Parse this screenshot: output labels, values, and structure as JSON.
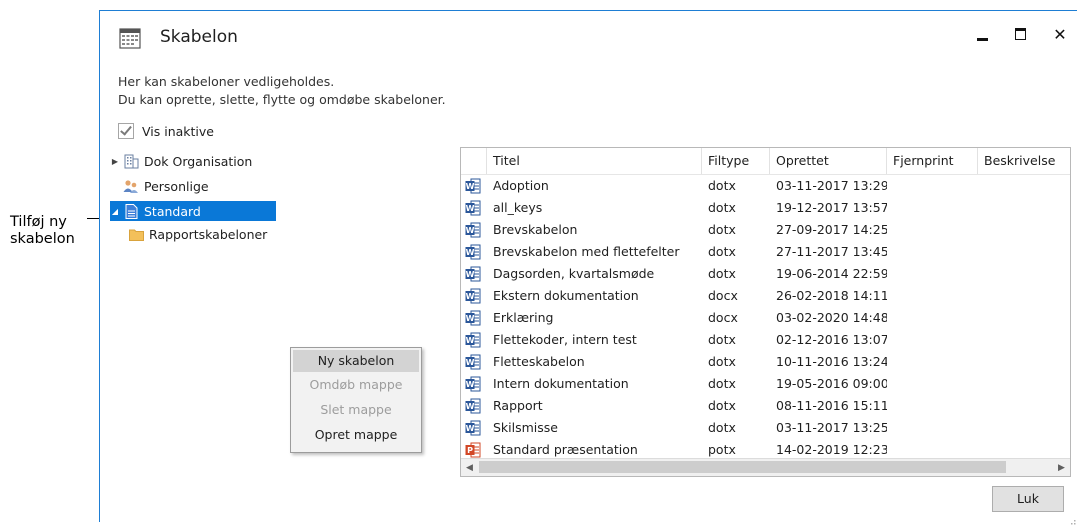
{
  "callout": {
    "text": "Tilføj ny skabelon"
  },
  "window": {
    "title": "Skabelon",
    "close_glyph": "✕",
    "description": [
      "Her kan skabeloner vedligeholdes.",
      "Du kan oprette, slette, flytte og omdøbe skabeloner."
    ],
    "show_inactive_label": "Vis inaktive",
    "show_inactive_checked": true,
    "close_button": "Luk"
  },
  "tree": {
    "items": [
      {
        "label": "Dok Organisation",
        "icon": "organization-icon",
        "expander": "▶"
      },
      {
        "label": "Personlige",
        "icon": "people-icon",
        "expander": ""
      },
      {
        "label": "Standard",
        "icon": "document-icon",
        "expander": "◢",
        "selected": true
      },
      {
        "label": "Rapportskabeloner",
        "icon": "folder-icon",
        "expander": ""
      }
    ]
  },
  "context_menu": {
    "items": [
      {
        "label": "Ny skabelon",
        "state": "highlighted"
      },
      {
        "label": "Omdøb mappe",
        "state": "disabled"
      },
      {
        "label": "Slet mappe",
        "state": "disabled"
      },
      {
        "label": "Opret mappe",
        "state": "enabled"
      }
    ]
  },
  "grid": {
    "columns": [
      "Titel",
      "Filtype",
      "Oprettet",
      "Fjernprint",
      "Beskrivelse"
    ],
    "rows": [
      {
        "icon": "word-icon",
        "title": "Adoption",
        "type": "dotx",
        "created": "03-11-2017 13:29",
        "remote": "",
        "desc": ""
      },
      {
        "icon": "word-icon",
        "title": "all_keys",
        "type": "dotx",
        "created": "19-12-2017 13:57",
        "remote": "",
        "desc": ""
      },
      {
        "icon": "word-icon",
        "title": "Brevskabelon",
        "type": "dotx",
        "created": "27-09-2017 14:25",
        "remote": "",
        "desc": ""
      },
      {
        "icon": "word-icon",
        "title": "Brevskabelon med flettefelter",
        "type": "dotx",
        "created": "27-11-2017 13:45",
        "remote": "",
        "desc": ""
      },
      {
        "icon": "word-icon",
        "title": "Dagsorden, kvartalsmøde",
        "type": "dotx",
        "created": "19-06-2014 22:59",
        "remote": "",
        "desc": ""
      },
      {
        "icon": "word-doc-icon",
        "title": "Ekstern dokumentation",
        "type": "docx",
        "created": "26-02-2018 14:11",
        "remote": "",
        "desc": ""
      },
      {
        "icon": "word-doc-icon",
        "title": "Erklæring",
        "type": "docx",
        "created": "03-02-2020 14:48",
        "remote": "",
        "desc": ""
      },
      {
        "icon": "word-icon",
        "title": "Flettekoder, intern test",
        "type": "dotx",
        "created": "02-12-2016 13:07",
        "remote": "",
        "desc": ""
      },
      {
        "icon": "word-icon",
        "title": "Fletteskabelon",
        "type": "dotx",
        "created": "10-11-2016 13:24",
        "remote": "",
        "desc": ""
      },
      {
        "icon": "word-icon",
        "title": "Intern dokumentation",
        "type": "dotx",
        "created": "19-05-2016 09:00",
        "remote": "",
        "desc": ""
      },
      {
        "icon": "word-icon",
        "title": "Rapport",
        "type": "dotx",
        "created": "08-11-2016 15:11",
        "remote": "",
        "desc": ""
      },
      {
        "icon": "word-icon",
        "title": "Skilsmisse",
        "type": "dotx",
        "created": "03-11-2017 13:25",
        "remote": "",
        "desc": ""
      },
      {
        "icon": "powerpoint-icon",
        "title": "Standard præsentation",
        "type": "potx",
        "created": "14-02-2019 12:23",
        "remote": "",
        "desc": ""
      }
    ],
    "scroll_left": "◀",
    "scroll_right": "▶"
  },
  "colors": {
    "accent": "#0a78d7",
    "word": "#2b579a",
    "powerpoint": "#d24726",
    "folder": "#f3c05a"
  }
}
